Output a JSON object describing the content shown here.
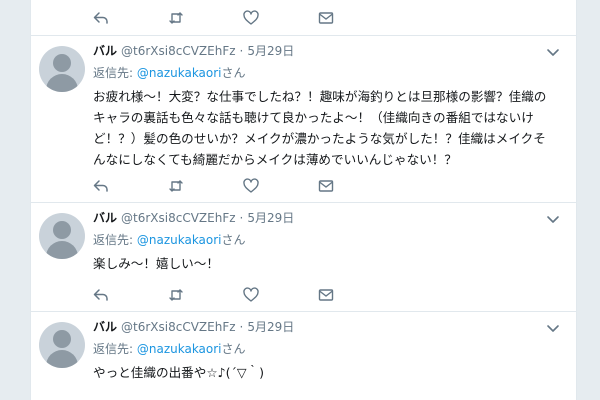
{
  "colors": {
    "background": "#e6ecf0",
    "card": "#ffffff",
    "link": "#1b95e0",
    "muted": "#657786",
    "text": "#14171a",
    "border": "#e1e8ed"
  },
  "icons": {
    "reply": "reply-icon",
    "retweet": "retweet-icon",
    "like": "heart-icon",
    "dm": "envelope-icon",
    "caret": "chevron-down-icon"
  },
  "tweets": [
    {
      "name": "バル",
      "handle": "@t6rXsi8cCVZEhFz",
      "sep": "·",
      "date": "5月29日",
      "reply_label": "返信先: ",
      "reply_mention": "@nazukakaori",
      "reply_suffix": "さん",
      "text": "お疲れ様～！大変？な仕事でしたね？！趣味が海釣りとは旦那様の影響？佳織のキャラの裏話も色々な話も聴けて良かったよ～！（佳織向きの番組ではないけど！？）髪の色のせいか？メイクが濃かったような気がした！？佳織はメイクそんなにしなくても綺麗だからメイクは薄めでいいんじゃない！？"
    },
    {
      "name": "バル",
      "handle": "@t6rXsi8cCVZEhFz",
      "sep": "·",
      "date": "5月29日",
      "reply_label": "返信先: ",
      "reply_mention": "@nazukakaori",
      "reply_suffix": "さん",
      "text": "楽しみ～！嬉しい～！"
    },
    {
      "name": "バル",
      "handle": "@t6rXsi8cCVZEhFz",
      "sep": "·",
      "date": "5月29日",
      "reply_label": "返信先: ",
      "reply_mention": "@nazukakaori",
      "reply_suffix": "さん",
      "text": "やっと佳織の出番や☆♪(´▽｀)"
    }
  ]
}
